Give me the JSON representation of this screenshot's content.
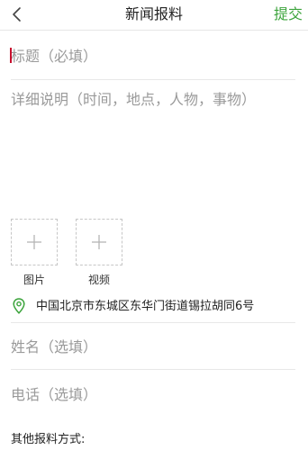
{
  "header": {
    "back_icon": "chevron-left-icon",
    "title": "新闻报料",
    "submit_label": "提交"
  },
  "form": {
    "title_placeholder": "标题（必填）",
    "title_value": "",
    "description_placeholder": "详细说明（时间，地点，人物，事物）",
    "description_value": "",
    "name_placeholder": "姓名（选填）",
    "name_value": "",
    "phone_placeholder": "电话（选填）",
    "phone_value": ""
  },
  "media": {
    "image_label": "图片",
    "video_label": "视频",
    "add_icon": "plus-icon"
  },
  "location": {
    "icon": "location-pin-icon",
    "address": "中国北京市东城区东华门街道锡拉胡同6号"
  },
  "other_methods_label": "其他报料方式:",
  "colors": {
    "accent": "#3da43d",
    "caret": "#c8102e",
    "placeholder": "#9a9a9a"
  }
}
